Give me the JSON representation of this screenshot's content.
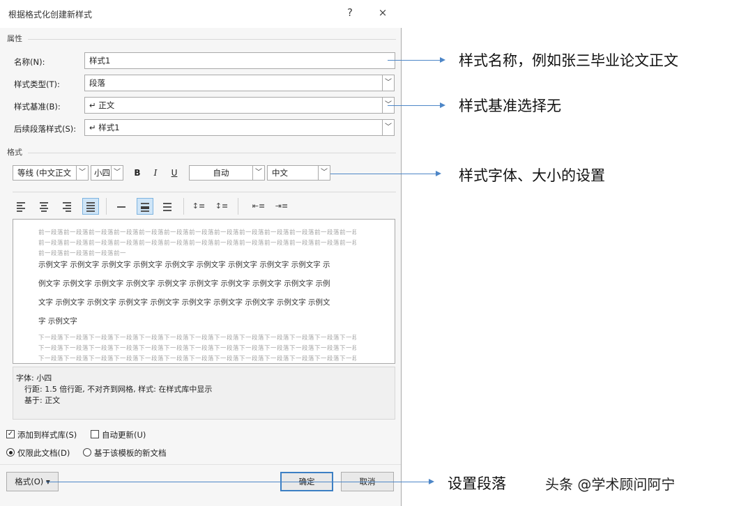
{
  "dialog": {
    "title": "根据格式化创建新样式",
    "help": "?",
    "close": "×"
  },
  "properties": {
    "section": "属性",
    "name_label": "名称(N):",
    "name_value": "样式1",
    "type_label": "样式类型(T):",
    "type_value": "段落",
    "based_label": "样式基准(B):",
    "based_value": "↵ 正文",
    "next_label": "后续段落样式(S):",
    "next_value": "↵ 样式1"
  },
  "format": {
    "section": "格式",
    "font_value": "等线 (中文正文",
    "size_value": "小四",
    "bold": "B",
    "italic": "I",
    "underline": "U",
    "color_value": "自动",
    "script_value": "中文"
  },
  "preview": {
    "prev_para": "前一段落前一段落前一段落前一段落前一段落前一段落前一段落前一段落前一段落前一段落前一段落前一段落前一段落前一段落前一段落前一段落",
    "sample_lines": [
      "示例文字 示例文字 示例文字 示例文字 示例文字 示例文字 示例文字 示例文字 示例文字 示",
      "例文字 示例文字 示例文字 示例文字 示例文字 示例文字 示例文字 示例文字 示例文字 示例",
      "文字 示例文字 示例文字 示例文字 示例文字 示例文字 示例文字 示例文字 示例文字 示例文",
      "字 示例文字"
    ],
    "next_para": "下一段落下一段落下一段落下一段落下一段落下一段落下一段落下一段落下一段落下一段落下一段落下一段落下一段落下一段落下一段落下一段落"
  },
  "description": {
    "line1": "字体: 小四",
    "line2": "行距: 1.5 倍行距, 不对齐到网格, 样式: 在样式库中显示",
    "line3": "基于: 正文"
  },
  "options": {
    "add_to_gallery": "添加到样式库(S)",
    "add_to_gallery_checked": true,
    "auto_update": "自动更新(U)",
    "auto_update_checked": false,
    "this_doc_only": "仅限此文档(D)",
    "new_docs": "基于该模板的新文档"
  },
  "buttons": {
    "format": "格式(O) ▾",
    "ok": "确定",
    "cancel": "取消"
  },
  "annotations": {
    "name_note": "样式名称，例如张三毕业论文正文",
    "based_note": "样式基准选择无",
    "font_note": "样式字体、大小的设置",
    "para_note": "设置段落"
  },
  "watermark": "头条 @学术顾问阿宁",
  "colors": {
    "arrow": "#4d86c7",
    "ok_border": "#3c7fc4",
    "selected_align": "#cfe5f7"
  }
}
